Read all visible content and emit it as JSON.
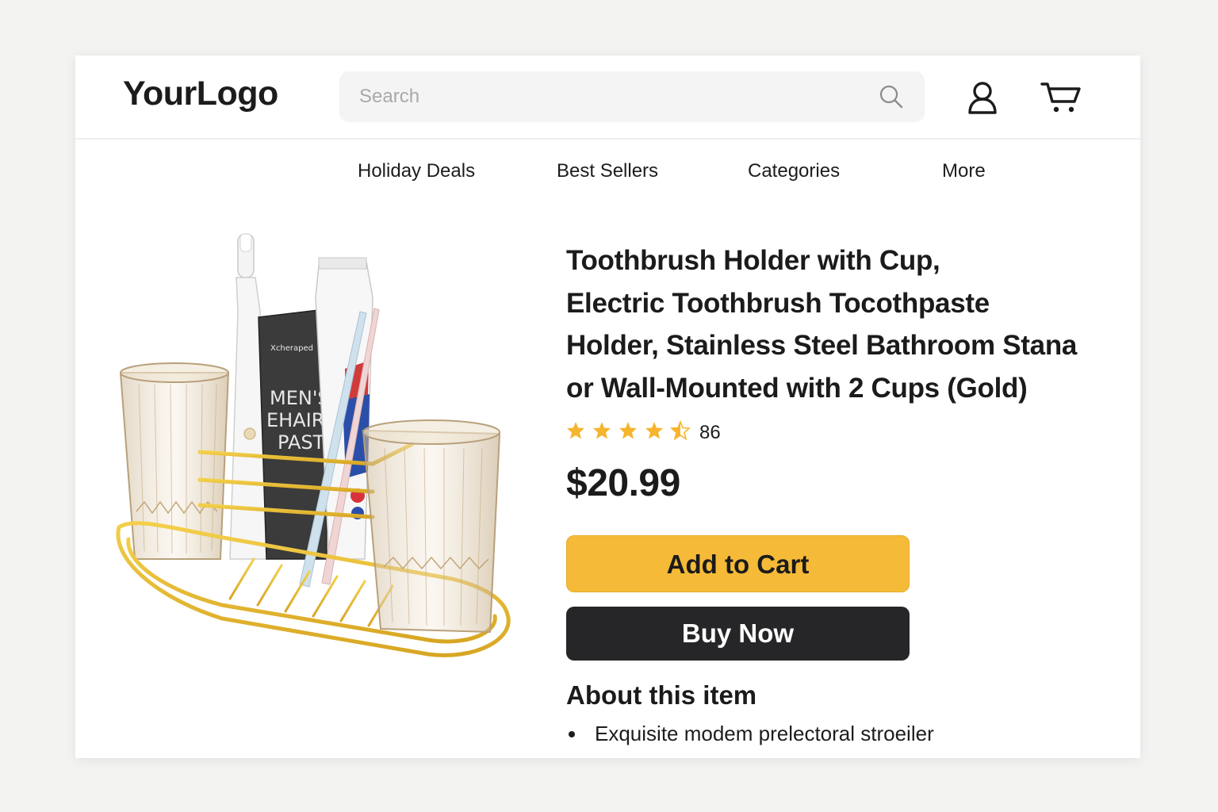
{
  "header": {
    "logo": "YourLogo",
    "search_placeholder": "Search",
    "icons": [
      "search-icon",
      "user-icon",
      "cart-icon"
    ]
  },
  "nav": {
    "items": [
      "Holiday Deals",
      "Best Sellers",
      "Categories",
      "More"
    ]
  },
  "product": {
    "title": "Toothbrush Holder with Cup,\nElectric Toothbrush Tocothpaste\nHolder, Stainless Steel Bathroom Stana\nor Wall-Mounted with 2 Cups (Gold)",
    "rating": 4.5,
    "review_count": "86",
    "price": "$20.99",
    "add_to_cart_label": "Add to Cart",
    "buy_now_label": "Buy Now",
    "image_text": {
      "paste_brand": "Xcheraped",
      "paste_lines": [
        "MEN'S",
        "EHAIRIN",
        "PAST"
      ]
    }
  },
  "about": {
    "heading": "About this item",
    "bullets": [
      "Exquisite modem prelectoral stroeiler"
    ]
  },
  "colors": {
    "accent": "#f5bb38",
    "dark_button": "#262628",
    "star": "#f5b52e",
    "background": "#f3f3f2"
  }
}
